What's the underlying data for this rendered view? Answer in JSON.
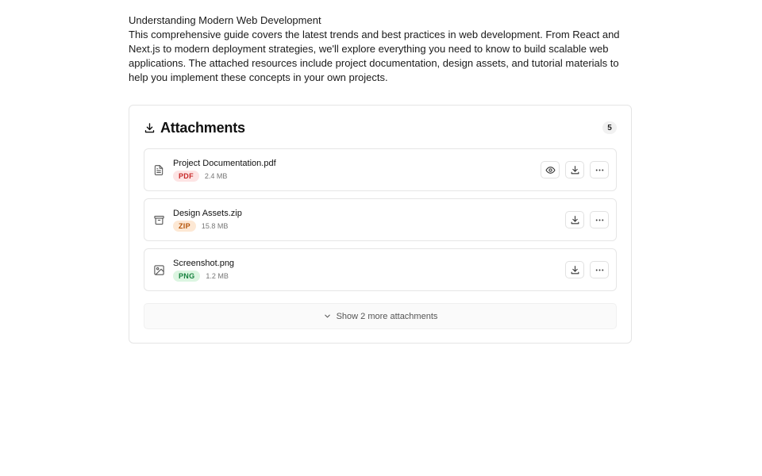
{
  "article": {
    "title": "Understanding Modern Web Development",
    "body": "This comprehensive guide covers the latest trends and best practices in web development. From React and Next.js to modern deployment strategies, we'll explore everything you need to know to build scalable web applications. The attached resources include project documentation, design assets, and tutorial materials to help you implement these concepts in your own projects."
  },
  "attachments": {
    "title": "Attachments",
    "count": "5",
    "header_icon": "download-icon",
    "items": [
      {
        "name": "Project Documentation.pdf",
        "type": "PDF",
        "size": "2.4 MB",
        "icon": "file-text-icon",
        "badge_bg": "#fde4e4",
        "badge_color": "#c62828",
        "actions": [
          "preview",
          "download",
          "more"
        ]
      },
      {
        "name": "Design Assets.zip",
        "type": "ZIP",
        "size": "15.8 MB",
        "icon": "archive-icon",
        "badge_bg": "#fde8d4",
        "badge_color": "#b45309",
        "actions": [
          "download",
          "more"
        ]
      },
      {
        "name": "Screenshot.png",
        "type": "PNG",
        "size": "1.2 MB",
        "icon": "image-icon",
        "badge_bg": "#dcf5e1",
        "badge_color": "#15803d",
        "actions": [
          "download",
          "more"
        ]
      }
    ],
    "show_more_label": "Show 2 more attachments"
  }
}
